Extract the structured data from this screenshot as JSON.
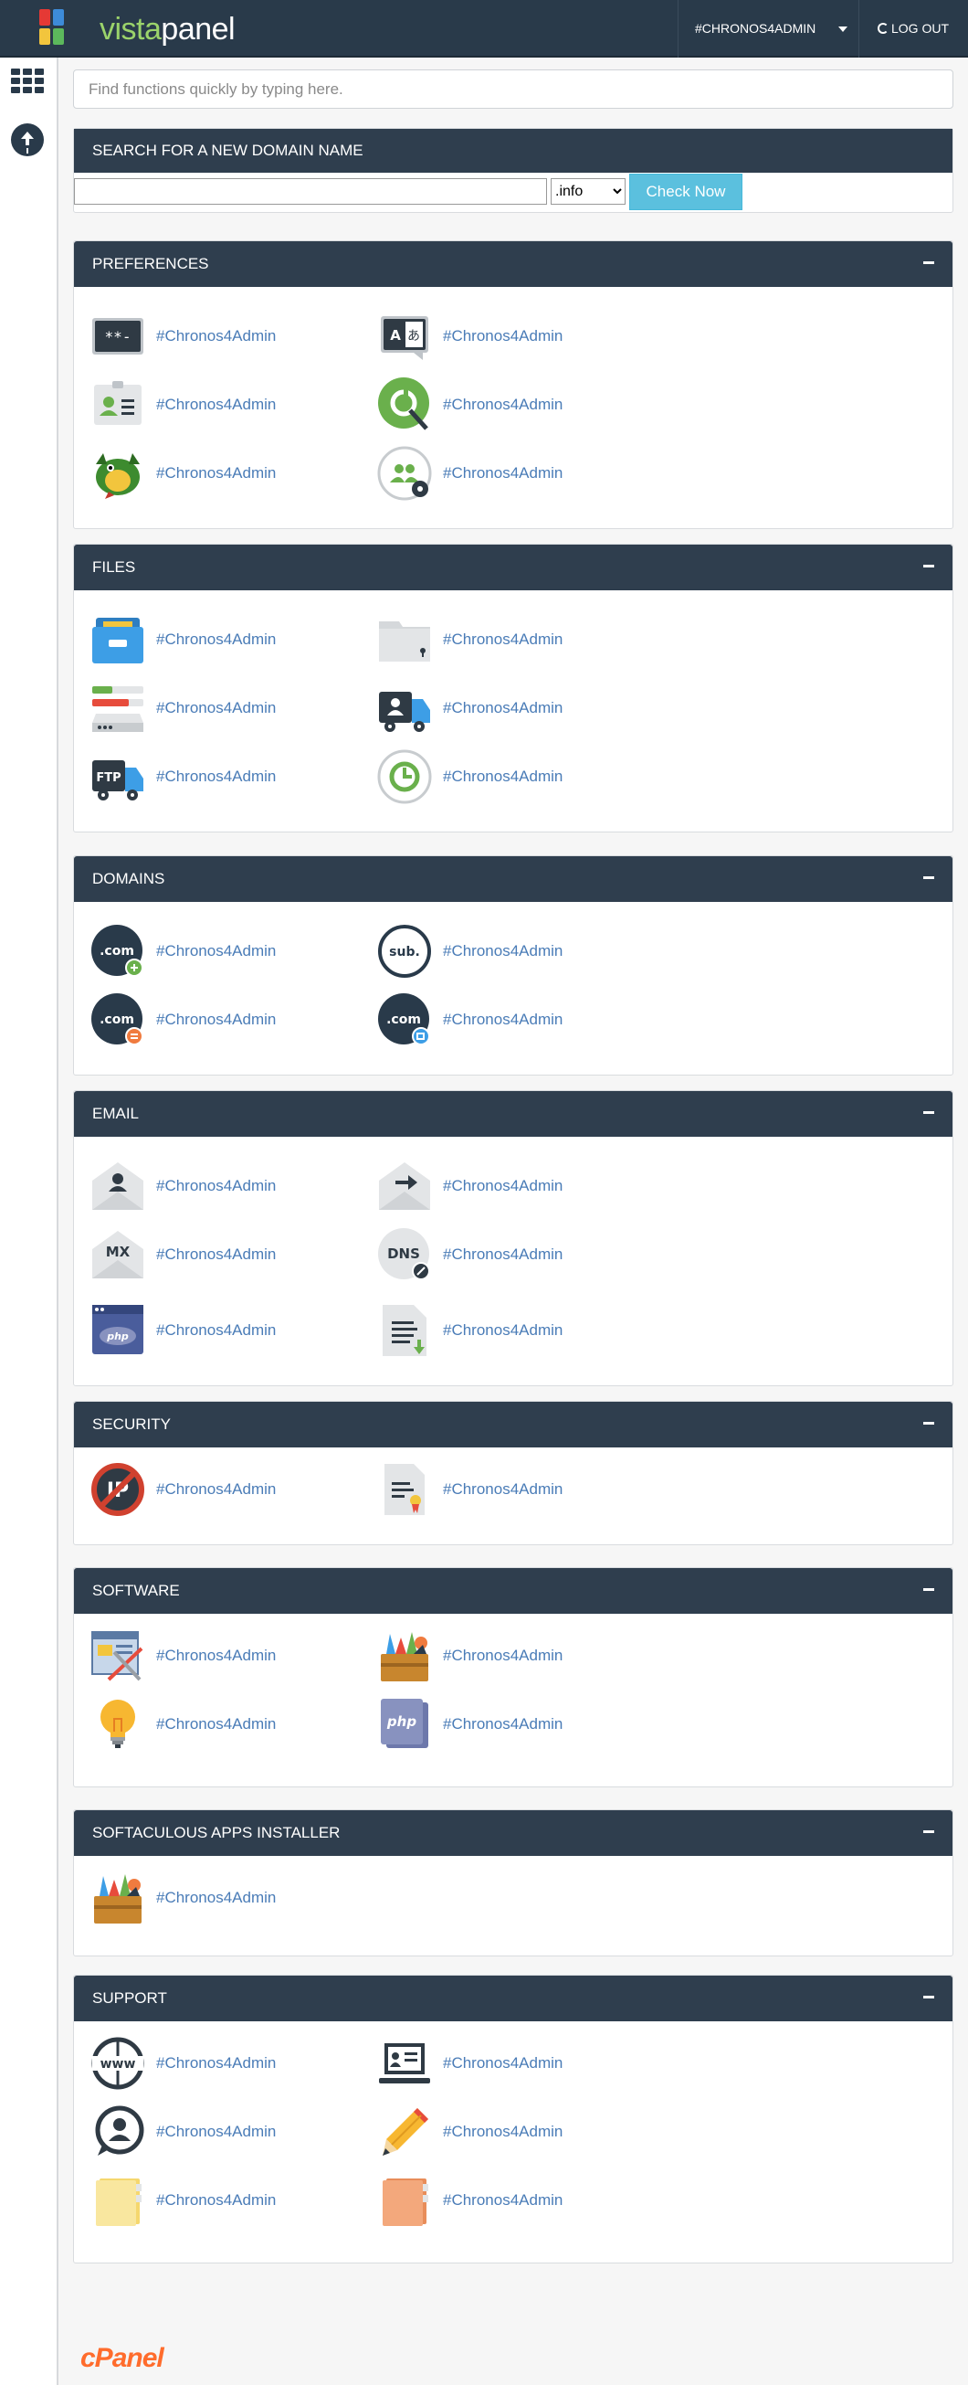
{
  "header": {
    "logo_prefix": "vista",
    "logo_suffix": "panel",
    "user_label": "#CHRONOS4ADMIN",
    "logout_label": "LOG OUT"
  },
  "sidebar": {
    "grid_icon": "apps-grid-icon",
    "upload_icon": "upload-icon"
  },
  "search": {
    "placeholder": "Find functions quickly by typing here."
  },
  "domain_search": {
    "title": "SEARCH FOR A NEW DOMAIN NAME",
    "tld_selected": ".info",
    "button": "Check Now"
  },
  "sections": {
    "preferences": {
      "title": "PREFERENCES",
      "items": [
        {
          "label": "#Chronos4Admin",
          "icon": "password-icon"
        },
        {
          "label": "#Chronos4Admin",
          "icon": "language-icon"
        },
        {
          "label": "#Chronos4Admin",
          "icon": "contact-info-icon"
        },
        {
          "label": "#Chronos4Admin",
          "icon": "stats-search-icon"
        },
        {
          "label": "#Chronos4Admin",
          "icon": "dragon-icon"
        },
        {
          "label": "#Chronos4Admin",
          "icon": "user-manager-icon"
        }
      ]
    },
    "files": {
      "title": "FILES",
      "items": [
        {
          "label": "#Chronos4Admin",
          "icon": "file-manager-icon"
        },
        {
          "label": "#Chronos4Admin",
          "icon": "directory-privacy-icon"
        },
        {
          "label": "#Chronos4Admin",
          "icon": "disk-usage-icon"
        },
        {
          "label": "#Chronos4Admin",
          "icon": "ftp-accounts-icon"
        },
        {
          "label": "#Chronos4Admin",
          "icon": "ftp-connections-icon"
        },
        {
          "label": "#Chronos4Admin",
          "icon": "backup-icon"
        }
      ]
    },
    "domains": {
      "title": "DOMAINS",
      "items": [
        {
          "label": "#Chronos4Admin",
          "icon": "addon-domain-icon"
        },
        {
          "label": "#Chronos4Admin",
          "icon": "subdomain-icon"
        },
        {
          "label": "#Chronos4Admin",
          "icon": "parked-domain-icon"
        },
        {
          "label": "#Chronos4Admin",
          "icon": "redirect-domain-icon"
        }
      ]
    },
    "email": {
      "title": "EMAIL",
      "items": [
        {
          "label": "#Chronos4Admin",
          "icon": "email-accounts-icon"
        },
        {
          "label": "#Chronos4Admin",
          "icon": "forwarders-icon"
        },
        {
          "label": "#Chronos4Admin",
          "icon": "mx-entry-icon"
        },
        {
          "label": "#Chronos4Admin",
          "icon": "dns-zone-icon"
        },
        {
          "label": "#Chronos4Admin",
          "icon": "php-config-icon"
        },
        {
          "label": "#Chronos4Admin",
          "icon": "email-import-icon"
        }
      ]
    },
    "security": {
      "title": "SECURITY",
      "items": [
        {
          "label": "#Chronos4Admin",
          "icon": "ip-blocker-icon"
        },
        {
          "label": "#Chronos4Admin",
          "icon": "ssl-certificate-icon"
        }
      ]
    },
    "software": {
      "title": "SOFTWARE",
      "items": [
        {
          "label": "#Chronos4Admin",
          "icon": "site-builder-icon"
        },
        {
          "label": "#Chronos4Admin",
          "icon": "softaculous-icon"
        },
        {
          "label": "#Chronos4Admin",
          "icon": "lightbulb-icon"
        },
        {
          "label": "#Chronos4Admin",
          "icon": "php-version-icon"
        }
      ]
    },
    "softaculous": {
      "title": "SOFTACULOUS APPS INSTALLER",
      "items": [
        {
          "label": "#Chronos4Admin",
          "icon": "softaculous-installer-icon"
        }
      ]
    },
    "support": {
      "title": "SUPPORT",
      "items": [
        {
          "label": "#Chronos4Admin",
          "icon": "www-globe-icon"
        },
        {
          "label": "#Chronos4Admin",
          "icon": "presentation-icon"
        },
        {
          "label": "#Chronos4Admin",
          "icon": "support-chat-icon"
        },
        {
          "label": "#Chronos4Admin",
          "icon": "pencil-icon"
        },
        {
          "label": "#Chronos4Admin",
          "icon": "yellow-folder-icon"
        },
        {
          "label": "#Chronos4Admin",
          "icon": "orange-folder-icon"
        }
      ]
    }
  },
  "footer": {
    "brand": "cPanel"
  }
}
